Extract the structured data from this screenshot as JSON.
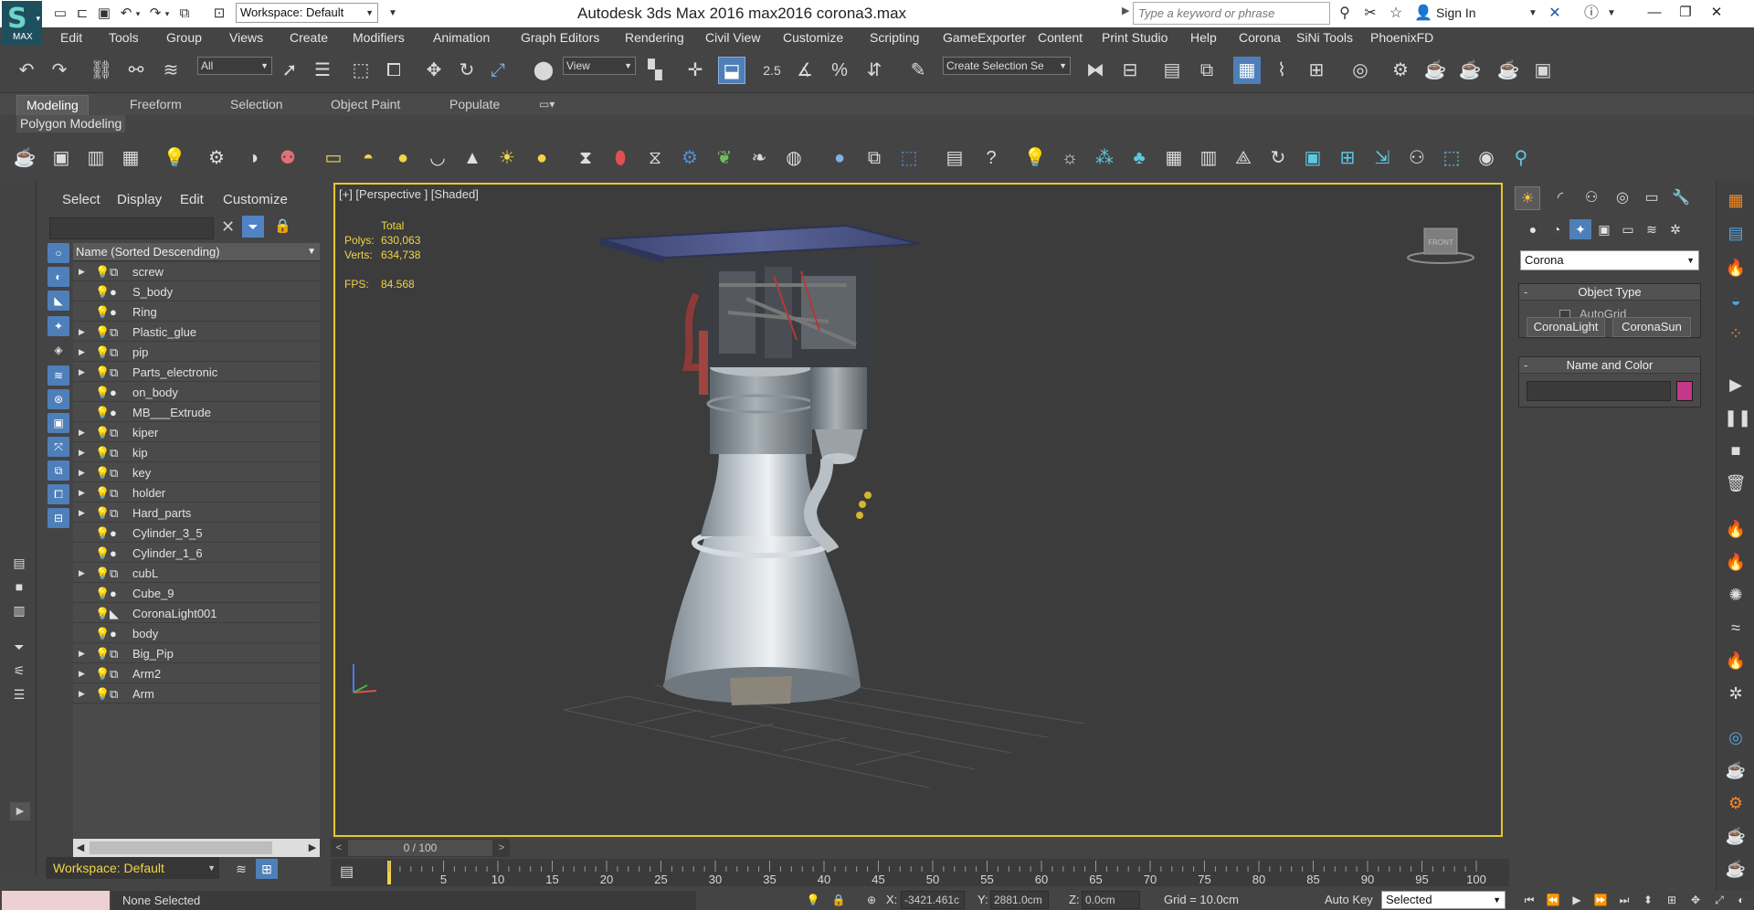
{
  "titlebar": {
    "logo_letter": "S",
    "logo_text": "MAX",
    "workspace": "Workspace: Default",
    "title": "Autodesk 3ds Max 2016      max2016 corona3.max",
    "search_placeholder": "Type a keyword or phrase",
    "sign_in": "Sign In"
  },
  "menubar": [
    "Edit",
    "Tools",
    "Group",
    "Views",
    "Create",
    "Modifiers",
    "Animation",
    "Graph Editors",
    "Rendering",
    "Civil View",
    "Customize",
    "Scripting",
    "GameExporter",
    "Content",
    "Print Studio",
    "Help",
    "Corona",
    "SiNi Tools",
    "PhoenixFD"
  ],
  "main_toolbar": {
    "selection_filter": "All",
    "ref_coord": "View",
    "angle_snap": "2.5",
    "named_selection": "Create Selection Se"
  },
  "ribbon": {
    "tabs": [
      "Modeling",
      "Freeform",
      "Selection",
      "Object Paint",
      "Populate"
    ],
    "active_tab": "Modeling",
    "panel_label": "Polygon Modeling"
  },
  "scene_explorer": {
    "menu": [
      "Select",
      "Display",
      "Edit",
      "Customize"
    ],
    "column_header": "Name (Sorted Descending)",
    "items": [
      {
        "name": "screw",
        "expandable": true,
        "type": "group"
      },
      {
        "name": "S_body",
        "expandable": false,
        "type": "sphere"
      },
      {
        "name": "Ring",
        "expandable": false,
        "type": "sphere"
      },
      {
        "name": "Plastic_glue",
        "expandable": true,
        "type": "group"
      },
      {
        "name": "pip",
        "expandable": true,
        "type": "group"
      },
      {
        "name": "Parts_electronic",
        "expandable": true,
        "type": "group"
      },
      {
        "name": "on_body",
        "expandable": false,
        "type": "sphere"
      },
      {
        "name": "MB___Extrude",
        "expandable": false,
        "type": "sphere"
      },
      {
        "name": "kiper",
        "expandable": true,
        "type": "group"
      },
      {
        "name": "kip",
        "expandable": true,
        "type": "group"
      },
      {
        "name": "key",
        "expandable": true,
        "type": "group"
      },
      {
        "name": "holder",
        "expandable": true,
        "type": "group"
      },
      {
        "name": "Hard_parts",
        "expandable": true,
        "type": "group"
      },
      {
        "name": "Cylinder_3_5",
        "expandable": false,
        "type": "sphere"
      },
      {
        "name": "Cylinder_1_6",
        "expandable": false,
        "type": "sphere"
      },
      {
        "name": "cubL",
        "expandable": true,
        "type": "group"
      },
      {
        "name": "Cube_9",
        "expandable": false,
        "type": "sphere"
      },
      {
        "name": "CoronaLight001",
        "expandable": false,
        "type": "light"
      },
      {
        "name": "body",
        "expandable": false,
        "type": "sphere"
      },
      {
        "name": "Big_Pip",
        "expandable": true,
        "type": "group"
      },
      {
        "name": "Arm2",
        "expandable": true,
        "type": "group"
      },
      {
        "name": "Arm",
        "expandable": true,
        "type": "group"
      }
    ],
    "workspace": "Workspace: Default"
  },
  "viewport": {
    "label": "[+] [Perspective ] [Shaded]",
    "stats_total": "Total",
    "polys_label": "Polys:",
    "polys_value": "630,063",
    "verts_label": "Verts:",
    "verts_value": "634,738",
    "fps_label": "FPS:",
    "fps_value": "84.568",
    "viewcube_face": "FRONT"
  },
  "command_panel": {
    "renderer_combo": "Corona",
    "object_type_title": "Object Type",
    "autogrid_label": "AutoGrid",
    "buttons": [
      "CoronaLight",
      "CoronaSun"
    ],
    "name_color_title": "Name and Color",
    "object_color": "#c3388a"
  },
  "time_slider": {
    "frame_display": "0 / 100",
    "tick_labels": [
      "5",
      "10",
      "15",
      "20",
      "25",
      "30",
      "35",
      "40",
      "45",
      "50",
      "55",
      "60",
      "65",
      "70",
      "75",
      "80",
      "85",
      "90",
      "95",
      "100"
    ]
  },
  "status_bar": {
    "selection_status": "None Selected",
    "x_label": "X:",
    "x_value": "-3421.461c",
    "y_label": "Y:",
    "y_value": "2881.0cm",
    "z_label": "Z:",
    "z_value": "0.0cm",
    "grid": "Grid = 10.0cm",
    "auto_key": "Auto Key",
    "key_filter": "Selected"
  },
  "colors": {
    "viewport_border": "#e6c72f",
    "stats_text": "#f2d447",
    "accent_blue": "#4f7fb8",
    "ui_background": "#444444"
  }
}
